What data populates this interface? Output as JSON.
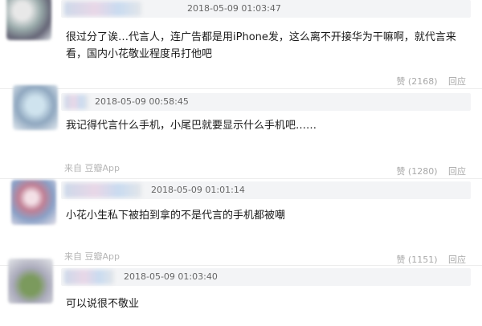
{
  "comments": [
    {
      "timestamp": "2018-05-09 01:03:47",
      "text": "很过分了诶…代言人，连广告都是用iPhone发，这么离不开接华为干嘛啊，就代言来看，国内小花敬业程度吊打他吧",
      "source": "",
      "likes": "赞 (2168)",
      "reply": "回应"
    },
    {
      "timestamp": "2018-05-09 00:58:45",
      "text": "我记得代言什么手机，小尾巴就要显示什么手机吧……",
      "source": "来自 豆瓣App",
      "likes": "赞 (1280)",
      "reply": "回应"
    },
    {
      "timestamp": "2018-05-09 01:01:14",
      "text": "小花小生私下被拍到拿的不是代言的手机都被嘲",
      "source": "来自 豆瓣App",
      "likes": "赞 (1151)",
      "reply": "回应"
    },
    {
      "timestamp": "2018-05-09 01:03:40",
      "text": "可以说很不敬业",
      "source": "",
      "likes": "",
      "reply": ""
    }
  ]
}
